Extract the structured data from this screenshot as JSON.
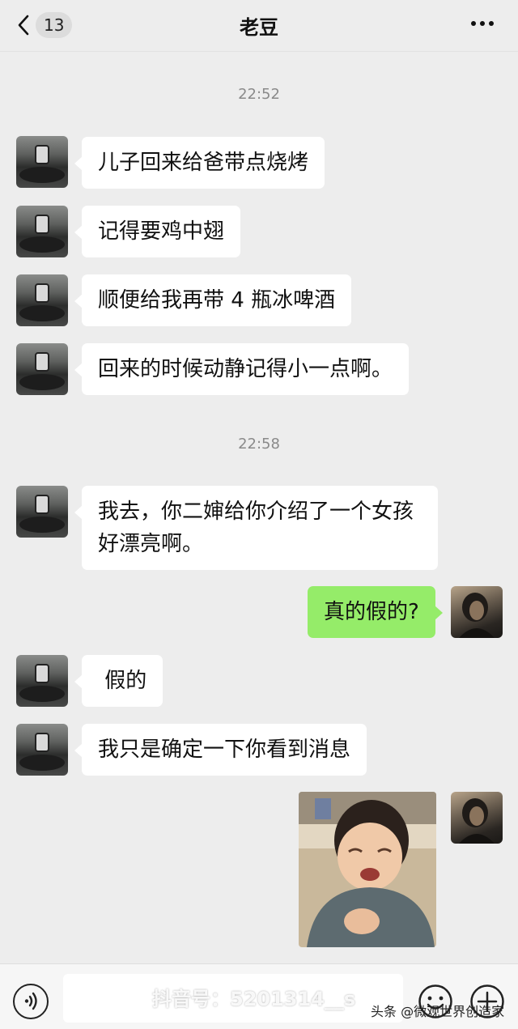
{
  "header": {
    "back_count": "13",
    "contact_name": "老豆"
  },
  "timestamps": [
    "22:52",
    "22:58"
  ],
  "messages": [
    {
      "from": "dad",
      "text": "儿子回来给爸带点烧烤"
    },
    {
      "from": "dad",
      "text": "记得要鸡中翅"
    },
    {
      "from": "dad",
      "text": "顺便给我再带 4 瓶冰啤酒"
    },
    {
      "from": "dad",
      "text": "回来的时候动静记得小一点啊。"
    },
    {
      "from": "dad",
      "text": "我去，你二婶给你介绍了一个女孩好漂亮啊。"
    },
    {
      "from": "me",
      "text": "真的假的?"
    },
    {
      "from": "dad",
      "text": " 假的"
    },
    {
      "from": "dad",
      "text": "我只是确定一下你看到消息"
    },
    {
      "from": "me",
      "type": "sticker",
      "text": ""
    }
  ],
  "watermarks": {
    "douyin": "抖音号：5201314__s",
    "toutiao": "头条 @微观世界创造家"
  },
  "colors": {
    "background": "#ededed",
    "incoming_bubble": "#ffffff",
    "outgoing_bubble": "#95ec69"
  },
  "icons": {
    "back": "chevron-left-icon",
    "more": "more-dots-icon",
    "voice": "voice-icon",
    "emoji": "emoji-icon",
    "plus": "plus-icon"
  }
}
